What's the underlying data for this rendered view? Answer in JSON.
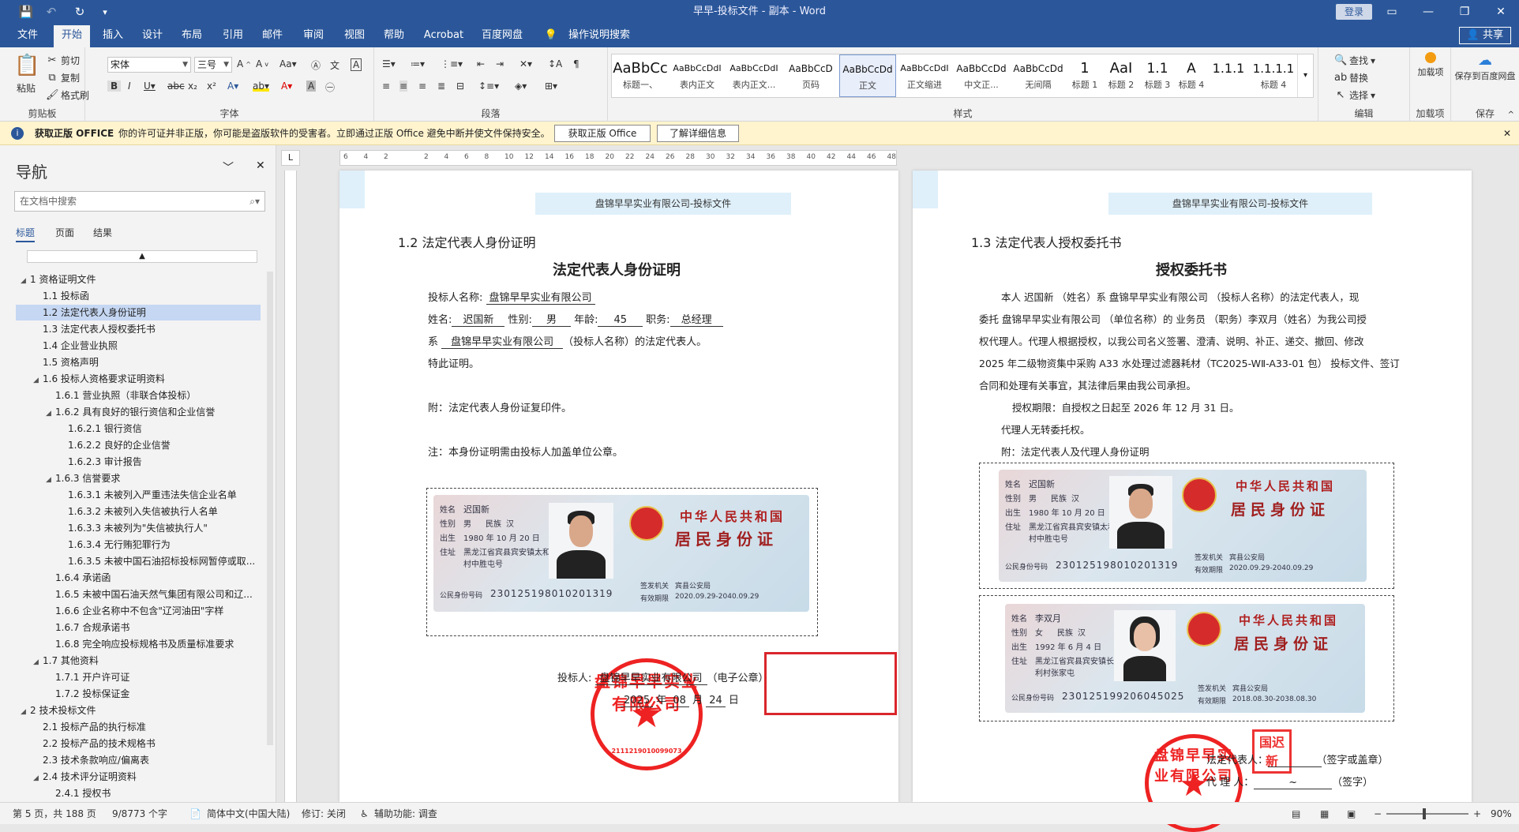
{
  "window": {
    "title": "早早-投标文件 - 副本 - Word",
    "login": "登录"
  },
  "tabs": [
    "文件",
    "开始",
    "插入",
    "设计",
    "布局",
    "引用",
    "邮件",
    "审阅",
    "视图",
    "帮助",
    "Acrobat",
    "百度网盘",
    "操作说明搜索"
  ],
  "share": "共享",
  "ribbon": {
    "clipboard": {
      "paste": "粘贴",
      "cut": "剪切",
      "copy": "复制",
      "format_painter": "格式刷",
      "label": "剪贴板"
    },
    "font": {
      "name": "宋体",
      "size": "三号",
      "label": "字体"
    },
    "paragraph": {
      "label": "段落"
    },
    "styles": {
      "label": "样式",
      "items": [
        {
          "preview": "AaBbCc",
          "name": "标题一、"
        },
        {
          "preview": "AaBbCcDdI",
          "name": "表内正文"
        },
        {
          "preview": "AaBbCcDdI",
          "name": "表内正文..."
        },
        {
          "preview": "AaBbCcD",
          "name": "页码"
        },
        {
          "preview": "AaBbCcDd",
          "name": "正文"
        },
        {
          "preview": "AaBbCcDdI",
          "name": "正文缩进"
        },
        {
          "preview": "AaBbCcDd",
          "name": "中文正..."
        },
        {
          "preview": "AaBbCcDd",
          "name": "无间隔"
        },
        {
          "preview": "1",
          "name": "标题 1"
        },
        {
          "preview": "AaI",
          "name": "标题 2"
        },
        {
          "preview": "1.1",
          "name": "标题 3"
        },
        {
          "preview": "A",
          "name": "标题 4"
        },
        {
          "preview": "1.1.1",
          "name": ""
        },
        {
          "preview": "1.1.1.1",
          "name": "标题 4"
        }
      ]
    },
    "editing": {
      "find": "查找",
      "replace": "替换",
      "select": "选择",
      "label": "编辑"
    },
    "addins": {
      "btn": "加载项",
      "label": "加载项"
    },
    "save": {
      "btn": "保存到百度网盘",
      "label": "保存"
    }
  },
  "warning": {
    "title": "获取正版 OFFICE",
    "text": "你的许可证并非正版，你可能是盗版软件的受害者。立即通过正版 Office 避免中断并使文件保持安全。",
    "btn1": "获取正版 Office",
    "btn2": "了解详细信息"
  },
  "nav": {
    "title": "导航",
    "search_placeholder": "在文档中搜索",
    "tabs": [
      "标题",
      "页面",
      "结果"
    ],
    "items": [
      {
        "level": 0,
        "arrow": "◢",
        "text": "1 资格证明文件"
      },
      {
        "level": 1,
        "arrow": "",
        "text": "1.1 投标函"
      },
      {
        "level": 1,
        "arrow": "",
        "text": "1.2 法定代表人身份证明",
        "selected": true
      },
      {
        "level": 1,
        "arrow": "",
        "text": "1.3 法定代表人授权委托书"
      },
      {
        "level": 1,
        "arrow": "",
        "text": "1.4 企业营业执照"
      },
      {
        "level": 1,
        "arrow": "",
        "text": "1.5 资格声明"
      },
      {
        "level": 1,
        "arrow": "◢",
        "text": "1.6 投标人资格要求证明资料"
      },
      {
        "level": 2,
        "arrow": "",
        "text": "1.6.1 营业执照（非联合体投标）"
      },
      {
        "level": 2,
        "arrow": "◢",
        "text": "1.6.2 具有良好的银行资信和企业信誉"
      },
      {
        "level": 3,
        "arrow": "",
        "text": "1.6.2.1 银行资信"
      },
      {
        "level": 3,
        "arrow": "",
        "text": "1.6.2.2 良好的企业信誉"
      },
      {
        "level": 3,
        "arrow": "",
        "text": "1.6.2.3 审计报告"
      },
      {
        "level": 2,
        "arrow": "◢",
        "text": "1.6.3 信誉要求"
      },
      {
        "level": 3,
        "arrow": "",
        "text": "1.6.3.1 未被列入严重违法失信企业名单"
      },
      {
        "level": 3,
        "arrow": "",
        "text": "1.6.3.2 未被列入失信被执行人名单"
      },
      {
        "level": 3,
        "arrow": "",
        "text": "1.6.3.3 未被列为\"失信被执行人\""
      },
      {
        "level": 3,
        "arrow": "",
        "text": "1.6.3.4 无行贿犯罪行为"
      },
      {
        "level": 3,
        "arrow": "",
        "text": "1.6.3.5 未被中国石油招标投标网暂停或取..."
      },
      {
        "level": 2,
        "arrow": "",
        "text": "1.6.4 承诺函"
      },
      {
        "level": 2,
        "arrow": "",
        "text": "1.6.5 未被中国石油天然气集团有限公司和辽..."
      },
      {
        "level": 2,
        "arrow": "",
        "text": "1.6.6 企业名称中不包含\"辽河油田\"字样"
      },
      {
        "level": 2,
        "arrow": "",
        "text": "1.6.7 合规承诺书"
      },
      {
        "level": 2,
        "arrow": "",
        "text": "1.6.8 完全响应投标规格书及质量标准要求"
      },
      {
        "level": 1,
        "arrow": "◢",
        "text": "1.7 其他资料"
      },
      {
        "level": 2,
        "arrow": "",
        "text": "1.7.1 开户许可证"
      },
      {
        "level": 2,
        "arrow": "",
        "text": "1.7.2 投标保证金"
      },
      {
        "level": 0,
        "arrow": "◢",
        "text": "2 技术投标文件"
      },
      {
        "level": 1,
        "arrow": "",
        "text": "2.1 投标产品的执行标准"
      },
      {
        "level": 1,
        "arrow": "",
        "text": "2.2 投标产品的技术规格书"
      },
      {
        "level": 1,
        "arrow": "",
        "text": "2.3 技术条款响应/偏离表"
      },
      {
        "level": 1,
        "arrow": "◢",
        "text": "2.4 技术评分证明资料"
      },
      {
        "level": 2,
        "arrow": "",
        "text": "2.4.1 授权书"
      }
    ]
  },
  "ruler": {
    "ticks": [
      "6",
      "4",
      "2",
      "",
      "2",
      "4",
      "6",
      "8",
      "10",
      "12",
      "14",
      "16",
      "18",
      "20",
      "22",
      "24",
      "26",
      "28",
      "30",
      "32",
      "34",
      "36",
      "38",
      "40",
      "42",
      "44",
      "46",
      "48"
    ],
    "corner": "L"
  },
  "page1": {
    "header": "盘锦早早实业有限公司-投标文件",
    "heading": "1.2    法定代表人身份证明",
    "title": "法定代表人身份证明",
    "bidder_label": "投标人名称:",
    "bidder": "盘锦早早实业有限公司",
    "name_label": "姓名:",
    "name": "迟国新",
    "sex_label": "性别:",
    "sex": "男",
    "age_label": "年龄:",
    "age": "45",
    "job_label": "职务:",
    "job": "总经理",
    "of_label": "系",
    "of_company": "盘锦早早实业有限公司",
    "of_suffix": "（投标人名称）的法定代表人。",
    "cert": "特此证明。",
    "attach": "附：法定代表人身份证复印件。",
    "note": "注：本身份证明需由投标人加盖单位公章。",
    "sign_label": "投标人:",
    "sign_company": "盘锦早早实业有限公司",
    "sign_suffix": "（电子公章）",
    "date_y": "2025",
    "date_m": "08",
    "date_d": "24",
    "year": "年",
    "month": "月",
    "day": "日"
  },
  "page2": {
    "header": "盘锦早早实业有限公司-投标文件",
    "heading": "1.3    法定代表人授权委托书",
    "title": "授权委托书",
    "line1": "本人  迟国新  （姓名）系  盘锦早早实业有限公司  （投标人名称）的法定代表人，现",
    "line2": "委托  盘锦早早实业有限公司  （单位名称）的  业务员  （职务）李双月（姓名）为我公司授",
    "line3": "权代理人。代理人根据授权，以我公司名义签署、澄清、说明、补正、递交、撤回、修改",
    "line4": "2025 年二级物资集中采购 A33 水处理过滤器耗材（TC2025-WⅡ-A33-01 包）  投标文件、签订",
    "line5": "合同和处理有关事宜，其法律后果由我公司承担。",
    "line6": "授权期限：自授权之日起至  2026  年  12  月  31  日。",
    "line7": "代理人无转委托权。",
    "line8": "附：法定代表人及代理人身份证明",
    "legal_label": "法定代表人：",
    "legal_suffix": "（签字或盖章）",
    "agent_label": "代  理  人：",
    "agent_suffix": "（签字）"
  },
  "id1": {
    "name_k": "姓名",
    "name": "迟国新",
    "sex_k": "性别",
    "sex": "男",
    "nation_k": "民族",
    "nation": "汉",
    "birth_k": "出生",
    "birth": "1980 年 10 月 20 日",
    "addr_k": "住址",
    "addr": "黑龙江省宾县宾安镇太和村中胜屯号",
    "idno_k": "公民身份号码",
    "idno": "230125198010201319",
    "country": "中华人民共和国",
    "card": "居民身份证",
    "issuer_k": "签发机关",
    "issuer": "宾县公安局",
    "valid_k": "有效期限",
    "valid": "2020.09.29-2040.09.29"
  },
  "id2": {
    "name_k": "姓名",
    "name": "李双月",
    "sex_k": "性别",
    "sex": "女",
    "nation_k": "民族",
    "nation": "汉",
    "birth_k": "出生",
    "birth": "1992 年 6 月 4 日",
    "addr_k": "住址",
    "addr": "黑龙江省宾县宾安镇长利村张家屯",
    "idno_k": "公民身份号码",
    "idno": "230125199206045025",
    "country": "中华人民共和国",
    "card": "居民身份证",
    "issuer_k": "签发机关",
    "issuer": "宾县公安局",
    "valid_k": "有效期限",
    "valid": "2018.08.30-2038.08.30"
  },
  "seal": {
    "text": "盘锦早早实业有限公司",
    "code": "2111219010099073",
    "small1": "国迟",
    "small2": "新"
  },
  "status": {
    "page": "第 5 页，共 188 页",
    "words": "9/8773 个字",
    "lang": "简体中文(中国大陆)",
    "track": "修订: 关闭",
    "access": "辅助功能: 调查",
    "zoom": "90%"
  },
  "colors": {
    "accent": "#2b579a",
    "seal": "#e22222",
    "highlight": "#c5d7f2"
  }
}
